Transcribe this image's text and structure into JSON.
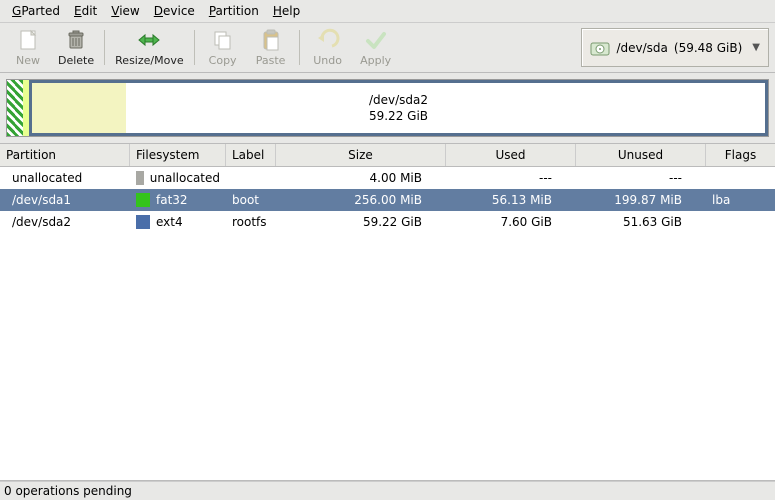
{
  "menu": {
    "gparted": "GParted",
    "edit": "Edit",
    "view": "View",
    "device": "Device",
    "partition": "Partition",
    "help": "Help"
  },
  "toolbar": {
    "new": "New",
    "delete": "Delete",
    "resize": "Resize/Move",
    "copy": "Copy",
    "paste": "Paste",
    "undo": "Undo",
    "apply": "Apply"
  },
  "device": {
    "name": "/dev/sda",
    "size": "(59.48 GiB)"
  },
  "graph": {
    "label_line1": "/dev/sda2",
    "label_line2": "59.22 GiB"
  },
  "columns": {
    "partition": "Partition",
    "filesystem": "Filesystem",
    "label": "Label",
    "size": "Size",
    "used": "Used",
    "unused": "Unused",
    "flags": "Flags"
  },
  "rows": [
    {
      "partition": "unallocated",
      "fs": "unallocated",
      "swatch": "sw-unalloc",
      "label": "",
      "size": "4.00 MiB",
      "used": "---",
      "unused": "---",
      "flags": ""
    },
    {
      "partition": "/dev/sda1",
      "fs": "fat32",
      "swatch": "sw-fat32",
      "label": "boot",
      "size": "256.00 MiB",
      "used": "56.13 MiB",
      "unused": "199.87 MiB",
      "flags": "lba"
    },
    {
      "partition": "/dev/sda2",
      "fs": "ext4",
      "swatch": "sw-ext4",
      "label": "rootfs",
      "size": "59.22 GiB",
      "used": "7.60 GiB",
      "unused": "51.63 GiB",
      "flags": ""
    }
  ],
  "status": "0 operations pending"
}
